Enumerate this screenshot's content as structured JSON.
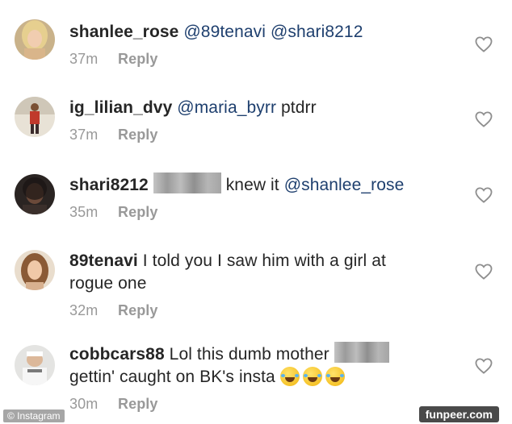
{
  "comments": [
    {
      "username": "shanlee_rose",
      "segments_1": [
        "@89tenavi @shari8212"
      ],
      "time": "37m",
      "reply": "Reply"
    },
    {
      "username": "ig_lilian_dvy",
      "mention": "@maria_byrr",
      "text": "ptdrr",
      "time": "37m",
      "reply": "Reply"
    },
    {
      "username": "shari8212",
      "text": "knew it",
      "mention": "@shanlee_rose",
      "time": "35m",
      "reply": "Reply"
    },
    {
      "username": "89tenavi",
      "text_line1": "I told you I saw him with a girl at",
      "text_line2": "rogue one",
      "time": "32m",
      "reply": "Reply"
    },
    {
      "username": "cobbcars88",
      "text_line1": "Lol this dumb mother",
      "text_line2": "gettin' caught on BK's insta",
      "emoji": "face-with-tears-of-joy-icon",
      "time": "30m",
      "reply": "Reply"
    }
  ],
  "watermarks": {
    "left": "© Instagram",
    "right": "funpeer.com"
  },
  "colors": {
    "mention": "#1e3f6e",
    "meta": "#999999",
    "text": "#262626"
  }
}
